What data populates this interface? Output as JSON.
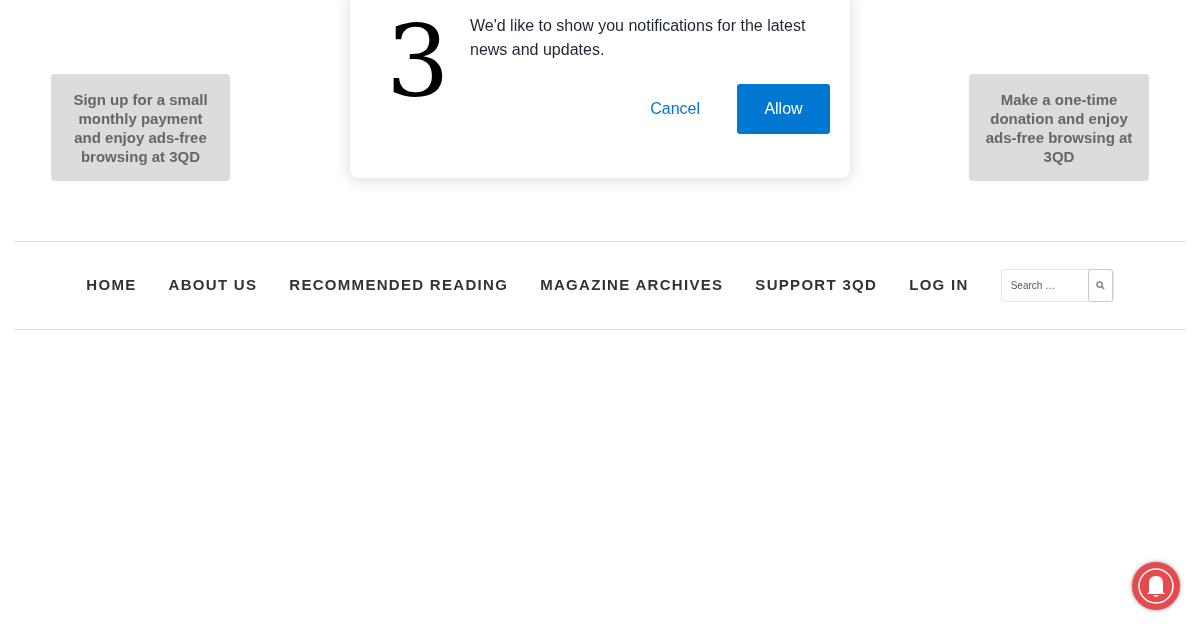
{
  "promos": [
    {
      "text": "Sign up for a small monthly payment and enjoy ads-free browsing at 3QD"
    },
    {
      "text": "Make a one-time donation and enjoy ads-free browsing at 3QD"
    }
  ],
  "notification_prompt": {
    "logo": "3",
    "message": "We'd like to show you notifications for the latest news and updates.",
    "buttons": [
      {
        "label": "Cancel",
        "kind": "secondary"
      },
      {
        "label": "Allow",
        "kind": "primary"
      }
    ]
  },
  "nav": {
    "items": [
      "HOME",
      "ABOUT US",
      "RECOMMENDED READING",
      "MAGAZINE ARCHIVES",
      "SUPPORT 3QD",
      "LOG IN"
    ],
    "search": {
      "placeholder": "Search …"
    }
  }
}
